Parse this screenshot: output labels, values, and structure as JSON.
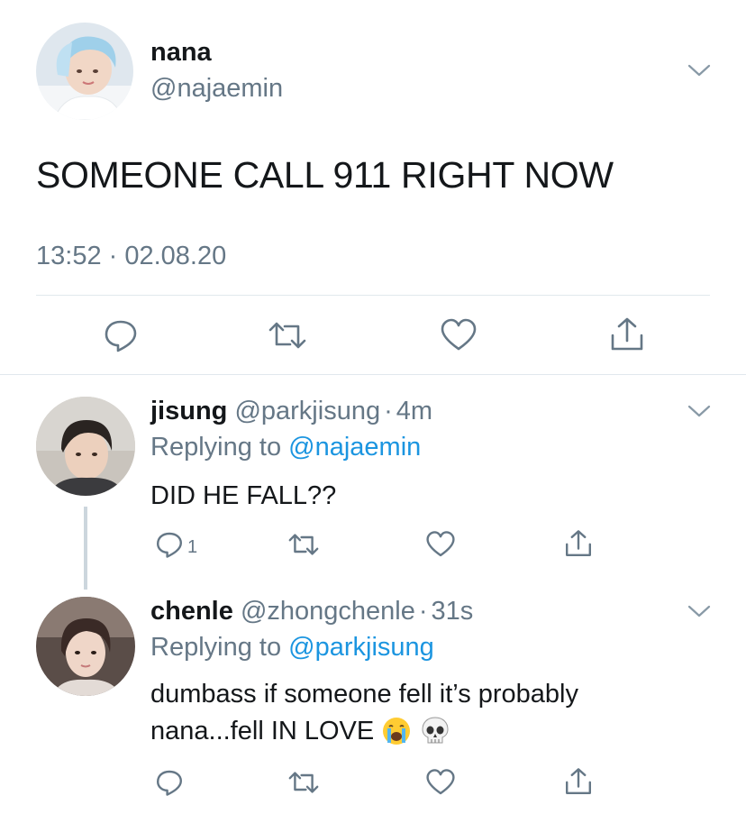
{
  "main_tweet": {
    "display_name": "nana",
    "handle": "@najaemin",
    "text": "SOMEONE CALL 911 RIGHT NOW",
    "timestamp": "13:52 · 02.08.20",
    "actions": [
      "reply-icon",
      "retweet-icon",
      "like-icon",
      "share-icon"
    ]
  },
  "replies": [
    {
      "display_name": "jisung",
      "handle": "@parkjisung",
      "separator": "·",
      "time": "4m",
      "replying_prefix": "Replying to",
      "replying_to": "@najaemin",
      "text": "DID HE FALL??",
      "reply_count": "1"
    },
    {
      "display_name": "chenle",
      "handle": "@zhongchenle",
      "separator": "·",
      "time": "31s",
      "replying_prefix": "Replying to",
      "replying_to": "@parkjisung",
      "text_line1": "dumbass if someone fell it’s probably",
      "text_line2": "nana...fell IN LOVE",
      "emojis": [
        "loudly-crying-face-emoji",
        "skull-emoji"
      ]
    }
  ],
  "colors": {
    "link": "#1b95e0",
    "muted": "#657786",
    "text": "#14171a",
    "divider": "#e1e8ed",
    "icon": "#657786"
  }
}
